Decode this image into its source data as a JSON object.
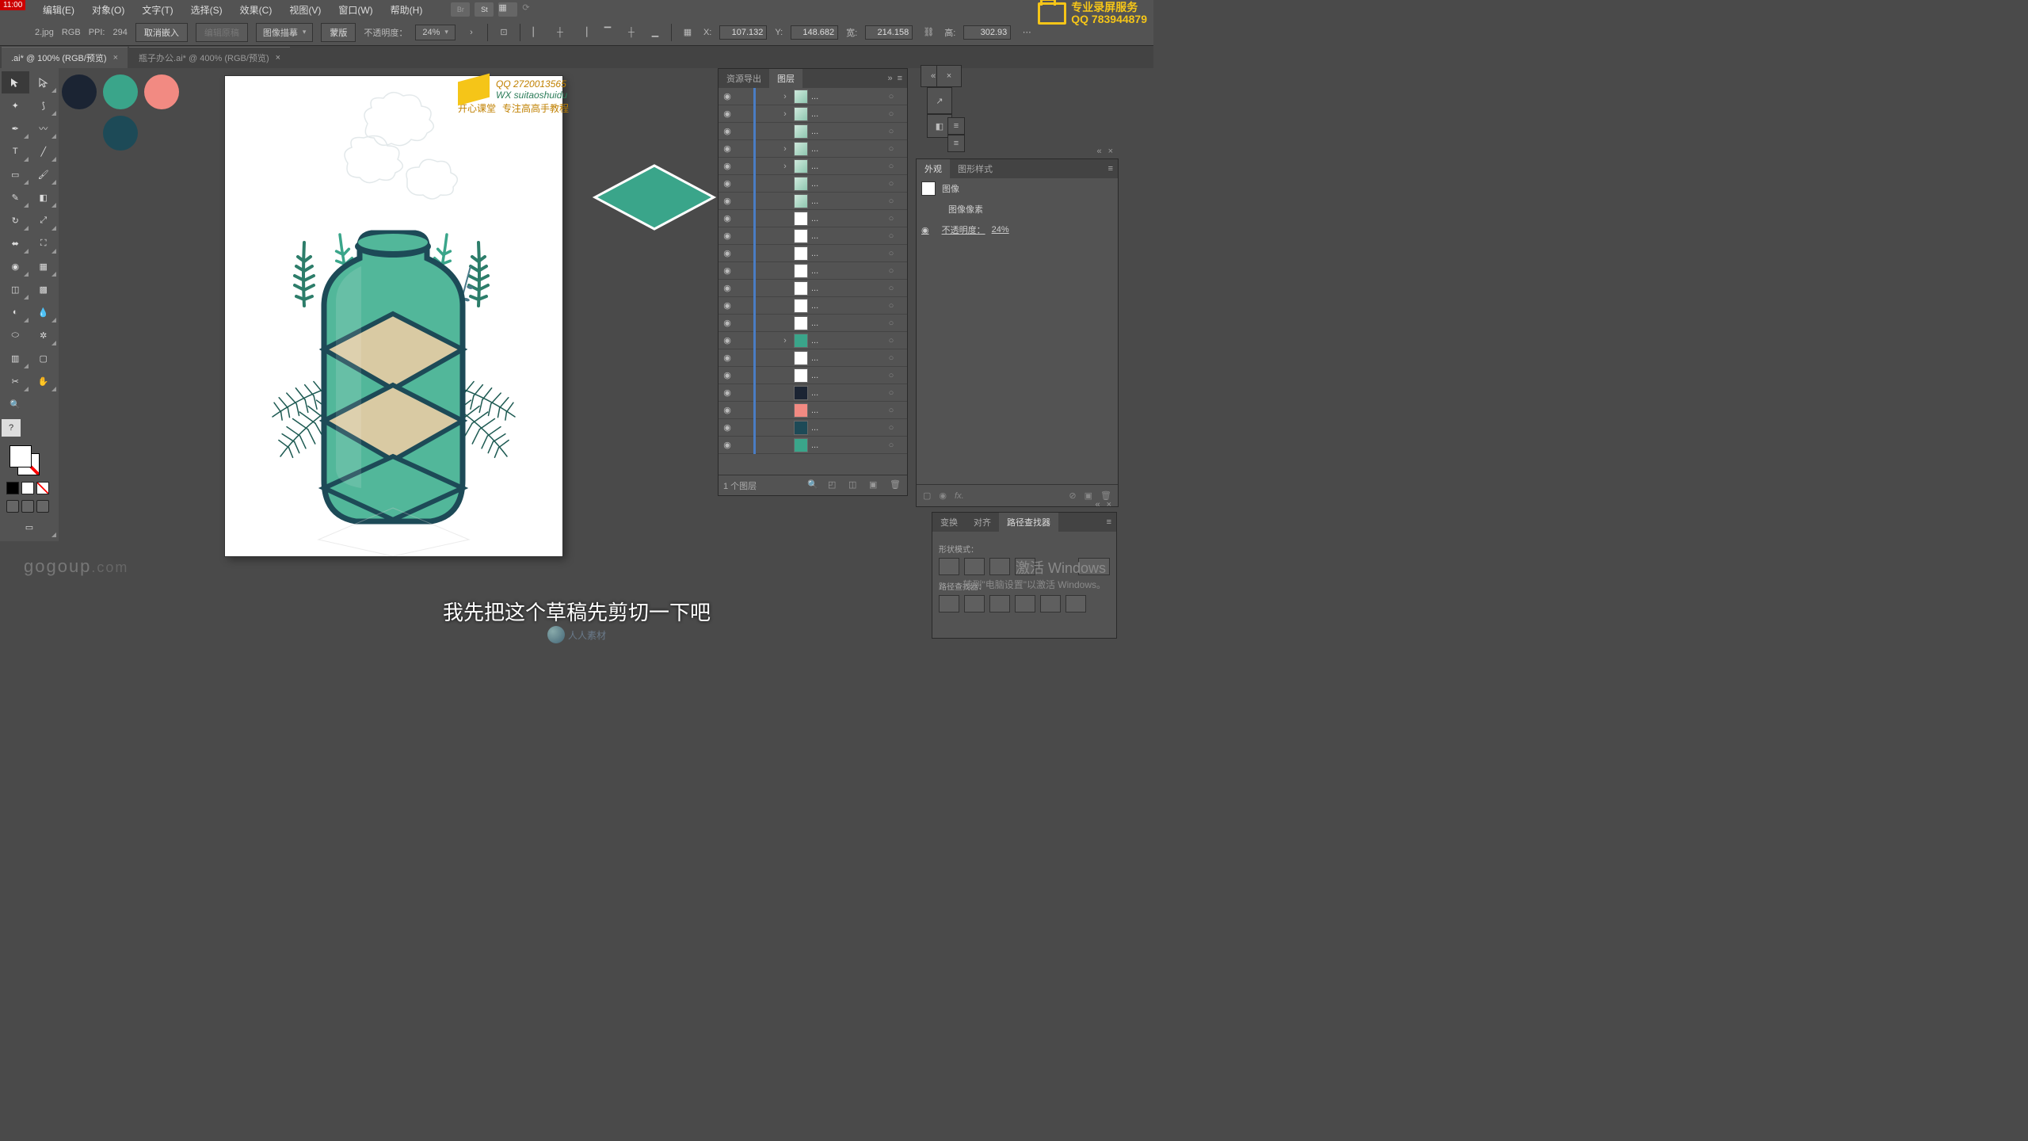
{
  "timestamp": "11:00",
  "watermark_right": {
    "line1": "专业录屏服务",
    "line2": "QQ 783944879"
  },
  "watermark_center": {
    "qq": "QQ 2720013565",
    "wx": "WX suitaoshuidu",
    "brand": "开心课堂",
    "slogan": "专注高高手教程"
  },
  "menus": [
    "编辑(E)",
    "对象(O)",
    "文字(T)",
    "选择(S)",
    "效果(C)",
    "视图(V)",
    "窗口(W)",
    "帮助(H)"
  ],
  "optbar": {
    "filelabel": "2.jpg",
    "mode": "RGB",
    "ppi_label": "PPI:",
    "ppi": "294",
    "btn_cancel_embed": "取消嵌入",
    "btn_edit_original": "编辑原稿",
    "dd_trace": "图像描摹",
    "btn_mask": "蒙版",
    "opacity_label": "不透明度：",
    "opacity": "24%",
    "x_label": "X:",
    "x": "107.132",
    "y_label": "Y:",
    "y": "148.682",
    "w_label": "宽:",
    "w": "214.158",
    "h_label": "高:",
    "h": "302.93"
  },
  "tabs": [
    {
      "label": ".ai* @ 100% (RGB/预览)",
      "active": true
    },
    {
      "label": "瓶子办公.ai* @ 400% (RGB/预览)",
      "active": false
    }
  ],
  "swatches": [
    "#1b2433",
    "#3aa58a",
    "#f28a82",
    "#1d4a57"
  ],
  "layers_panel": {
    "tab_export": "资源导出",
    "tab_layers": "图层",
    "rows": [
      {
        "thumb": "leaf",
        "exp": true
      },
      {
        "thumb": "leaf",
        "exp": true
      },
      {
        "thumb": "leaf"
      },
      {
        "thumb": "leaf",
        "exp": true
      },
      {
        "thumb": "leaf",
        "exp": true
      },
      {
        "thumb": "leaf"
      },
      {
        "thumb": "leaf"
      },
      {
        "thumb": "white"
      },
      {
        "thumb": "white"
      },
      {
        "thumb": "white"
      },
      {
        "thumb": "white"
      },
      {
        "thumb": "white"
      },
      {
        "thumb": "white"
      },
      {
        "thumb": "white"
      },
      {
        "thumb": "teal",
        "exp": true
      },
      {
        "thumb": "white"
      },
      {
        "thumb": "white"
      },
      {
        "thumb": "navy"
      },
      {
        "thumb": "coral"
      },
      {
        "thumb": "darkteal"
      },
      {
        "thumb": "teal2"
      }
    ],
    "ellipsis": "...",
    "footer": "1 个图层"
  },
  "appearance_panel": {
    "tab_appear": "外观",
    "tab_gstyle": "图形样式",
    "row_image": "图像",
    "row_pixel": "图像像素",
    "row_opacity_label": "不透明度：",
    "row_opacity_val": "24%"
  },
  "path_panel": {
    "tab_transform": "变换",
    "tab_align": "对齐",
    "tab_pathfinder": "路径查找器",
    "label_shapemode": "形状模式：",
    "label_pathfinder": "路径查找器："
  },
  "activate": {
    "l1": "激活 Windows",
    "l2": "转到\"电脑设置\"以激活 Windows。"
  },
  "gogoup": "gogoup",
  "gogoup_suffix": ".com",
  "subtitle": "我先把这个草稿先剪切一下吧",
  "rr": "人人素材"
}
